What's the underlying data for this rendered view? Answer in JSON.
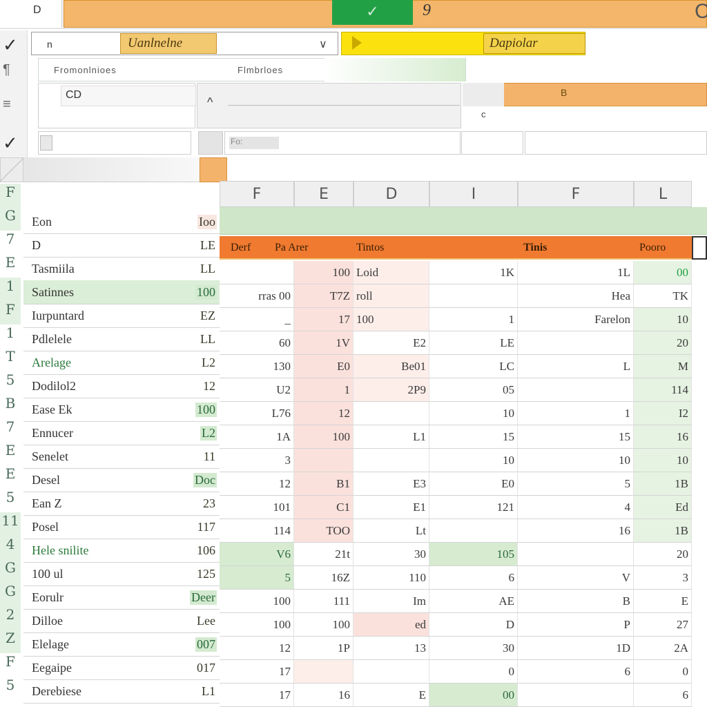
{
  "ribbon": {
    "name_box": "D",
    "title_mid": "9",
    "title_right": "C",
    "green_block_label": "✓",
    "dropdown_value": "n",
    "dropdown_highlight": "Uanlnelne",
    "yellow_label": "Dapiolar",
    "panel_text_1": "Fromonlnioes",
    "panel_text_2": "Flmbrloes",
    "box_a_label": "CD",
    "box_b_caret": "^",
    "c_label": "c",
    "formula_text": "Fo: ",
    "orange_icon": "B"
  },
  "left_tools": {
    "check_1": "✓",
    "check_2": "✓",
    "tool_a": "¶",
    "tool_b": "≡"
  },
  "columns": [
    "F",
    "E",
    "D",
    "I",
    "F",
    "L"
  ],
  "band": {
    "c1": "Derf",
    "c2": "Pa Arer",
    "c3": "Tintos",
    "c4": "Tinis",
    "c5": "Pooro"
  },
  "row_numbers": [
    "F",
    "G",
    "7",
    "E",
    "1",
    "F",
    "1",
    "T",
    "5",
    "B",
    "7",
    "E",
    "E",
    "5",
    "11",
    "4",
    "G",
    "G",
    "2",
    "Z",
    "F",
    "5"
  ],
  "rows": [
    {
      "name": "Eon",
      "val": "Ioo"
    },
    {
      "name": "D",
      "val": "LE"
    },
    {
      "name": "Tasmiila",
      "val": "LL"
    },
    {
      "name": "Satinnes",
      "val": "100"
    },
    {
      "name": "Iurpuntard",
      "val": "EZ"
    },
    {
      "name": "Pdlelele",
      "val": "LL"
    },
    {
      "name": "Arelage",
      "val": "L2"
    },
    {
      "name": "Dodilol2",
      "val": "12"
    },
    {
      "name": "Ease Ek",
      "val": "100"
    },
    {
      "name": "Ennucer",
      "val": "L2"
    },
    {
      "name": "Senelet",
      "val": "11"
    },
    {
      "name": "Desel",
      "val": "Doc"
    },
    {
      "name": "Ean Z",
      "val": "23"
    },
    {
      "name": "Posel",
      "val": "117"
    },
    {
      "name": "Hele snilite",
      "val": "106"
    },
    {
      "name": "100 ul",
      "val": "125"
    },
    {
      "name": "Eorulr",
      "val": "Deer"
    },
    {
      "name": "Dilloe",
      "val": "Lee"
    },
    {
      "name": "Elelage",
      "val": "007"
    },
    {
      "name": "Eegaipe",
      "val": "017"
    },
    {
      "name": "Derebiese",
      "val": "L1"
    }
  ],
  "grid": [
    [
      "",
      "100",
      "Loid",
      "1K",
      "1L",
      "00"
    ],
    [
      "rras 00",
      "T7Z",
      "roll",
      "",
      "Hea",
      "TK"
    ],
    [
      "_",
      "17",
      "100",
      "1",
      "Farelon",
      "10"
    ],
    [
      "60",
      "1V",
      "E2",
      "LE",
      "",
      "20"
    ],
    [
      "130",
      "E0",
      "Be01",
      "LC",
      "L",
      "M"
    ],
    [
      "U2",
      "1",
      "2P9",
      "05",
      "",
      "114"
    ],
    [
      "L76",
      "12",
      "",
      "10",
      "1",
      "I2"
    ],
    [
      "1A",
      "100",
      "L1",
      "15",
      "15",
      "16"
    ],
    [
      "3",
      "",
      "",
      "10",
      "10",
      "10"
    ],
    [
      "12",
      "B1",
      "E3",
      "E0",
      "5",
      "1B"
    ],
    [
      "101",
      "C1",
      "E1",
      "121",
      "4",
      "Ed"
    ],
    [
      "114",
      "TOO",
      "Lt",
      "",
      "16",
      "1B"
    ],
    [
      "V6",
      "21t",
      "30",
      "105",
      "",
      "20"
    ],
    [
      "5",
      "16Z",
      "110",
      "6",
      "V",
      "3"
    ],
    [
      "100",
      "111",
      "Im",
      "AE",
      "B",
      "E"
    ],
    [
      "100",
      "100",
      "ed",
      "D",
      "P",
      "27"
    ],
    [
      "12",
      "1P",
      "13",
      "30",
      "1D",
      "2A"
    ],
    [
      "17",
      "",
      "",
      "0",
      "6",
      "0"
    ],
    [
      "17",
      "16",
      "E",
      "00",
      "",
      "6"
    ]
  ],
  "colors": {
    "title_bar": "#f4b66a",
    "green_block": "#22a046",
    "yellow_button": "#fbe20f",
    "orange_band": "#ef7a30",
    "green_band": "#cfe6c8",
    "pink_cell": "#fbe1dc",
    "green_cell": "#d6ebd0"
  }
}
